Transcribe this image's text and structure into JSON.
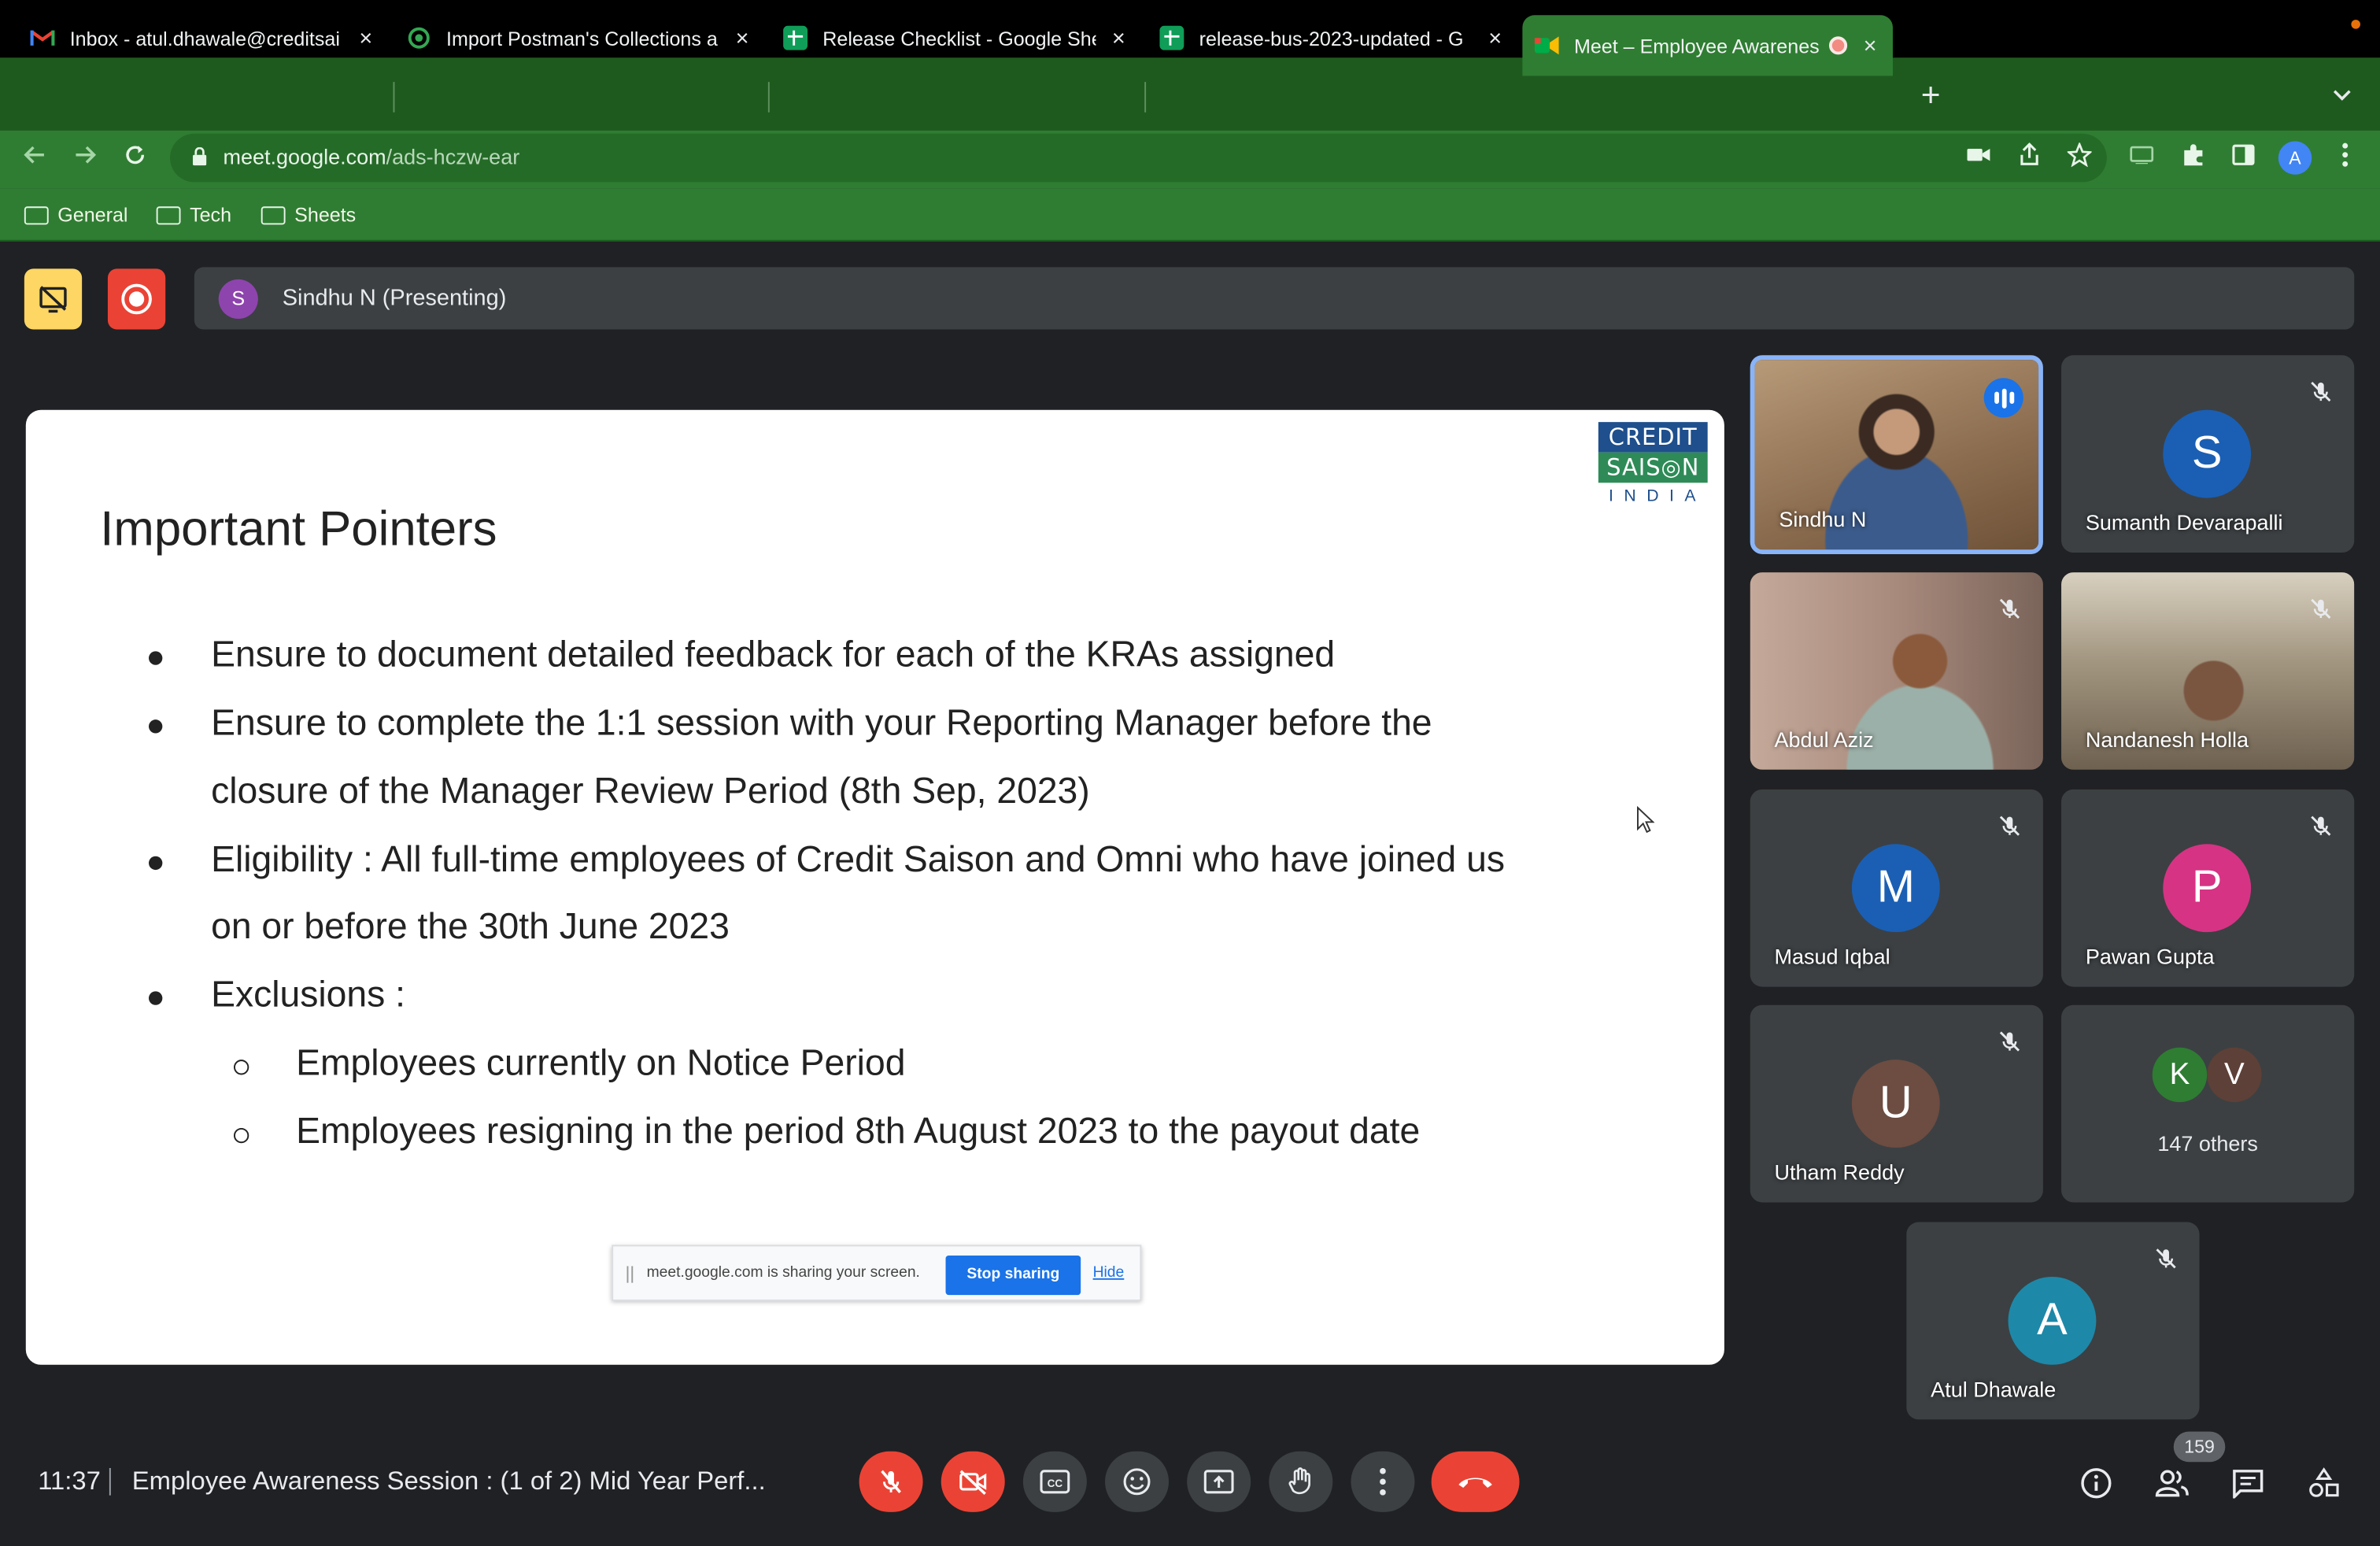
{
  "browser": {
    "tabs": [
      {
        "title": "Inbox - atul.dhawale@creditsai",
        "icon": "gmail-icon"
      },
      {
        "title": "Import Postman's Collections a",
        "icon": "postman-icon"
      },
      {
        "title": "Release Checklist - Google She",
        "icon": "sheets-icon"
      },
      {
        "title": "release-bus-2023-updated - G",
        "icon": "sheets-icon"
      },
      {
        "title": "Meet – Employee Awarenes",
        "icon": "meet-icon"
      }
    ],
    "url_host": "meet.google.com",
    "url_path": "/ads-hczw-ear",
    "profile_initial": "A",
    "bookmarks": [
      "General",
      "Tech",
      "Sheets"
    ]
  },
  "meet": {
    "presenter_initial": "S",
    "presenter_label": "Sindhu N (Presenting)",
    "slide": {
      "title": "Important Pointers",
      "logo": {
        "line1": "CREDIT",
        "line2": "SAIS◎N",
        "line3": "INDIA"
      },
      "bullets": [
        "Ensure to document detailed feedback for each of the KRAs assigned",
        "Ensure to complete the 1:1 session with your Reporting Manager before the",
        "closure of the Manager Review Period (8th Sep, 2023)",
        "Eligibility : All full-time employees of Credit Saison and Omni who have joined us",
        "on or before the 30th June 2023",
        "Exclusions :"
      ],
      "sub_bullets": [
        "Employees currently on Notice Period",
        "Employees resigning in the period 8th August 2023 to the payout date"
      ],
      "share_bar": {
        "message": "meet.google.com is sharing your screen.",
        "stop": "Stop sharing",
        "hide": "Hide"
      }
    },
    "participants": [
      {
        "name": "Sindhu N",
        "initial": "",
        "color": ""
      },
      {
        "name": "Sumanth Devarapalli",
        "initial": "S",
        "color": "#1a5fb4"
      },
      {
        "name": "Abdul Aziz",
        "initial": "",
        "color": ""
      },
      {
        "name": "Nandanesh Holla",
        "initial": "",
        "color": ""
      },
      {
        "name": "Masud Iqbal",
        "initial": "M",
        "color": "#1a5fb4"
      },
      {
        "name": "Pawan Gupta",
        "initial": "P",
        "color": "#d63384"
      },
      {
        "name": "Utham Reddy",
        "initial": "U",
        "color": "#6d4c41"
      },
      {
        "name": "Atul Dhawale",
        "initial": "A",
        "color": "#1e88a8"
      }
    ],
    "others": {
      "initials": [
        "K",
        "V"
      ],
      "colors": [
        "#2e7d32",
        "#5d4037"
      ],
      "label": "147 others"
    },
    "bottom": {
      "time": "11:37",
      "meeting_title": "Employee Awareness Session : (1 of 2) Mid Year Perf...",
      "people_count": "159"
    }
  }
}
